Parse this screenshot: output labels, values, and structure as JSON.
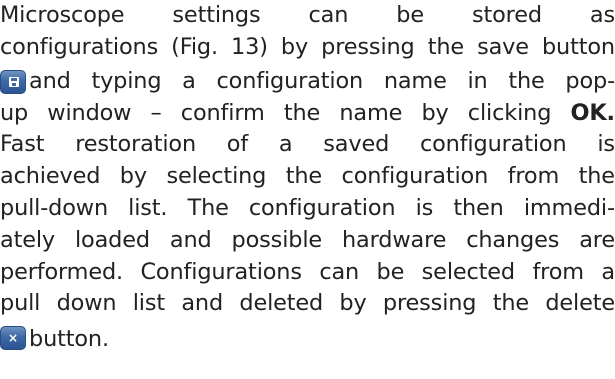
{
  "paragraph": {
    "line1_words": [
      "Microscope",
      "settings",
      "can",
      "be",
      "stored",
      "as"
    ],
    "line2_words": [
      "configurations",
      "(Fig.",
      "13)",
      "by",
      "pressing",
      "the",
      "save",
      "button"
    ],
    "line3_words": [
      "and",
      "typing",
      "a",
      "configuration",
      "name",
      "in",
      "the",
      "pop-"
    ],
    "line4_words": [
      "up",
      "window",
      "–",
      "confirm",
      "the",
      "name",
      "by",
      "clicking",
      "OK."
    ],
    "line5_words": [
      "Fast",
      "restoration",
      "of",
      "a",
      "saved",
      "configuration",
      "is"
    ],
    "line6_words": [
      "achieved",
      "by",
      "selecting",
      "the",
      "configuration",
      "from",
      "the"
    ],
    "line7_words": [
      "pull-down",
      "list.",
      "The",
      "configuration",
      "is",
      "then",
      "immedi-"
    ],
    "line8_words": [
      "ately",
      "loaded",
      "and",
      "possible",
      "hardware",
      "changes",
      "are"
    ],
    "line9_words": [
      "performed.",
      "Configurations",
      "can",
      "be",
      "selected",
      "from",
      "a"
    ],
    "line10_words": [
      "pull",
      "down",
      "list",
      "and",
      "deleted",
      "by",
      "pressing",
      "the",
      "delete"
    ],
    "line11_text": "button."
  },
  "icons": {
    "save": "save-icon",
    "delete": "delete-icon",
    "delete_glyph": "×",
    "accent": "#3e69a6"
  }
}
